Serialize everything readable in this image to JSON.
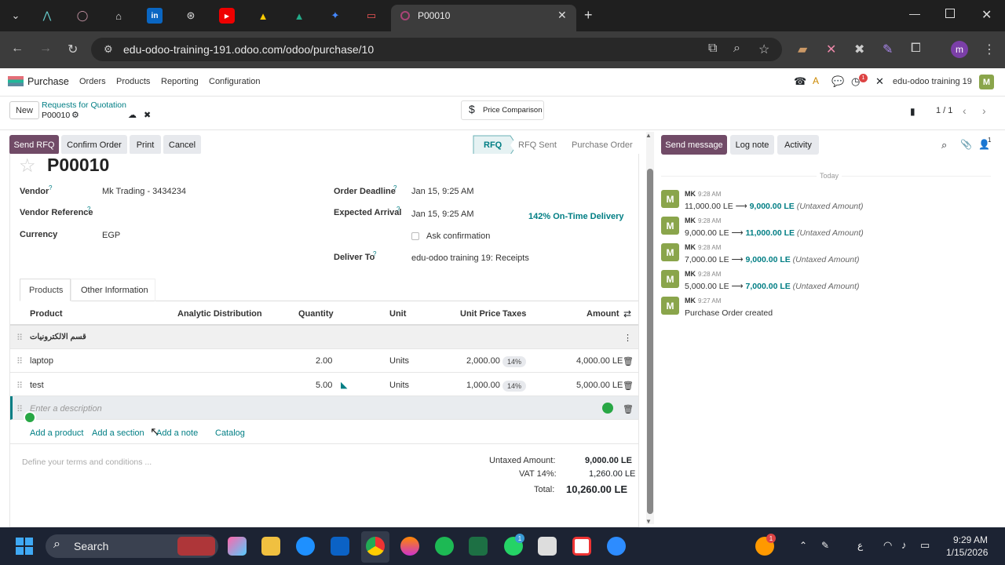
{
  "browser": {
    "tab_title": "P00010",
    "url": "edu-odoo-training-191.odoo.com/odoo/purchase/10",
    "profile_initial": "m"
  },
  "nav": {
    "app": "Purchase",
    "menus": [
      "Orders",
      "Products",
      "Reporting",
      "Configuration"
    ],
    "company": "edu-odoo training 19",
    "user_initial": "M",
    "notif_count": "1"
  },
  "control": {
    "new_label": "New",
    "breadcrumb_parent": "Requests for Quotation",
    "record_name": "P00010",
    "price_comparison": "Price Comparison",
    "pager": "1 / 1"
  },
  "actions": {
    "send_rfq": "Send RFQ",
    "confirm": "Confirm Order",
    "print": "Print",
    "cancel": "Cancel"
  },
  "statusbar": [
    "RFQ",
    "RFQ Sent",
    "Purchase Order"
  ],
  "form": {
    "title": "P00010",
    "vendor_label": "Vendor",
    "vendor": "Mk Trading - 3434234",
    "vendor_ref_label": "Vendor Reference",
    "currency_label": "Currency",
    "currency": "EGP",
    "order_deadline_label": "Order Deadline",
    "order_deadline": "Jan 15, 9:25 AM",
    "expected_arrival_label": "Expected Arrival",
    "expected_arrival": "Jan 15, 9:25 AM",
    "on_time": "142% On-Time Delivery",
    "ask_confirmation": "Ask confirmation",
    "deliver_to_label": "Deliver To",
    "deliver_to": "edu-odoo training 19: Receipts"
  },
  "tabs": [
    "Products",
    "Other Information"
  ],
  "lines": {
    "headers": [
      "Product",
      "Analytic Distribution",
      "Quantity",
      "Unit",
      "Unit Price",
      "Taxes",
      "Amount"
    ],
    "section": "قسم الالكترونيات",
    "rows": [
      {
        "product": "laptop",
        "qty": "2.00",
        "unit": "Units",
        "price": "2,000.00",
        "tax": "14%",
        "amount": "4,000.00 LE"
      },
      {
        "product": "test",
        "qty": "5.00",
        "unit": "Units",
        "price": "1,000.00",
        "tax": "14%",
        "amount": "5,000.00 LE"
      }
    ],
    "description_placeholder": "Enter a description",
    "add_product": "Add a product",
    "add_section": "Add a section",
    "add_note": "Add a note",
    "catalog": "Catalog"
  },
  "totals": {
    "terms_placeholder": "Define your terms and conditions ...",
    "untaxed_label": "Untaxed Amount:",
    "untaxed": "9,000.00 LE",
    "vat_label": "VAT 14%:",
    "vat": "1,260.00 LE",
    "total_label": "Total:",
    "total": "10,260.00 LE"
  },
  "chatter": {
    "send_message": "Send message",
    "log_note": "Log note",
    "activity": "Activity",
    "follower_count": "1",
    "today": "Today",
    "messages": [
      {
        "author": "MK",
        "time": "9:28 AM",
        "from": "11,000.00 LE",
        "to": "9,000.00 LE",
        "field": "(Untaxed Amount)"
      },
      {
        "author": "MK",
        "time": "9:28 AM",
        "from": "9,000.00 LE",
        "to": "11,000.00 LE",
        "field": "(Untaxed Amount)"
      },
      {
        "author": "MK",
        "time": "9:28 AM",
        "from": "7,000.00 LE",
        "to": "9,000.00 LE",
        "field": "(Untaxed Amount)"
      },
      {
        "author": "MK",
        "time": "9:28 AM",
        "from": "5,000.00 LE",
        "to": "7,000.00 LE",
        "field": "(Untaxed Amount)"
      }
    ],
    "created": {
      "author": "MK",
      "time": "9:27 AM",
      "text": "Purchase Order created"
    }
  },
  "taskbar": {
    "search": "Search",
    "lang": "ع",
    "time": "9:29 AM",
    "date": "1/15/2026",
    "firefox_badge": "1",
    "whatsapp_badge": "1"
  }
}
